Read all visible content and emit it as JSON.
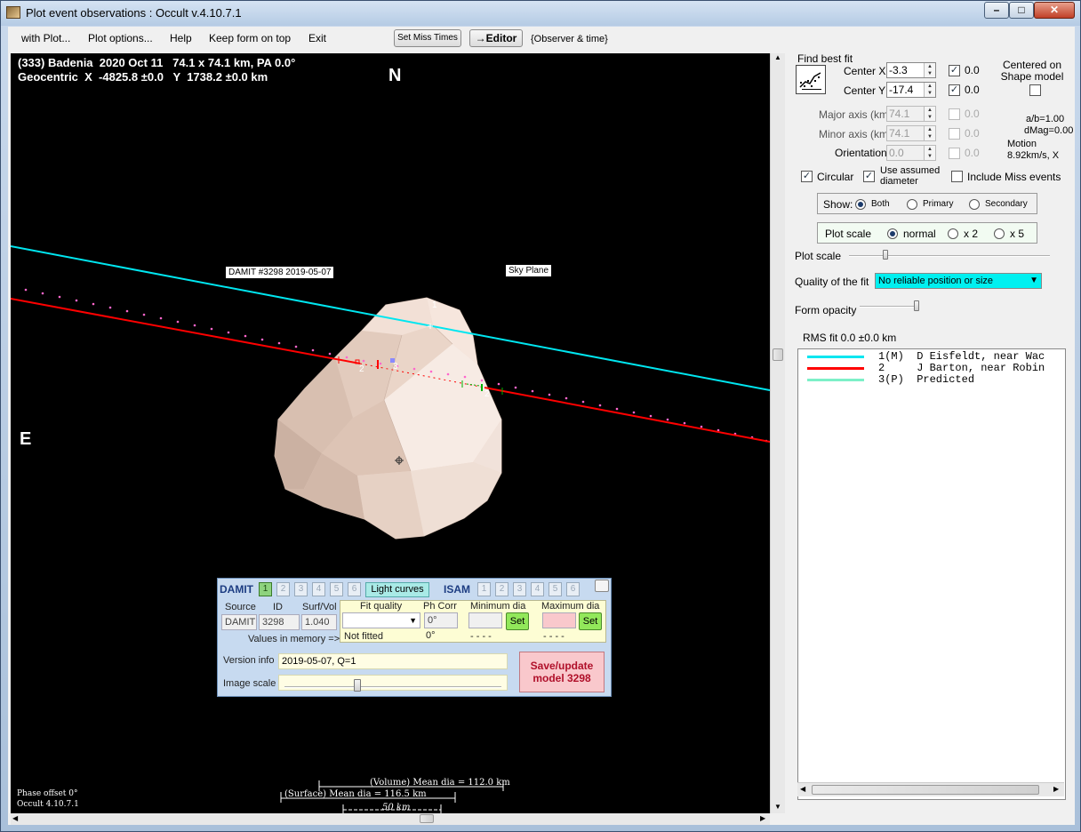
{
  "window": {
    "title": "Plot event observations : Occult v.4.10.7.1"
  },
  "menu": {
    "items": [
      "with Plot...",
      "Plot options...",
      "Help",
      "Keep form on top",
      "Exit"
    ],
    "set_miss_times": "Set Miss Times",
    "editor": "→Editor",
    "observer_time": "{Observer & time}"
  },
  "plot": {
    "header_line1": "(333) Badenia  2020 Oct 11   74.1 x 74.1 km, PA 0.0°",
    "header_line2": "Geocentric  X  -4825.8 ±0.0   Y  1738.2 ±0.0 km",
    "north": "N",
    "east": "E",
    "damit_tag": "DAMIT #3298 2019-05-07",
    "sky_plane_tag": "Sky Plane",
    "chord_labels": [
      "1",
      "2",
      "3",
      "2"
    ],
    "phase_offset": "Phase offset 0°",
    "occult_version": "Occult 4.10.7.1",
    "volume_mean_dia": "(Volume) Mean dia = 112.0 km",
    "surface_mean_dia": "(Surface) Mean dia = 116.5 km",
    "scale_bar": "50 km",
    "colors": {
      "chord1": "#00e6f0",
      "chord2": "#ff0000",
      "predicted": "#ff66cc",
      "body": "#ecd8cc"
    }
  },
  "damit": {
    "label": "DAMIT",
    "isam_label": "ISAM",
    "model_numbers": [
      "1",
      "2",
      "3",
      "4",
      "5",
      "6"
    ],
    "active_model": "1",
    "light_curves": "Light curves",
    "source_header": "Source",
    "id_header": "ID",
    "surfvol_header": "Surf/Vol",
    "source_value": "DAMIT",
    "id_value": "3298",
    "surfvol_value": "1.040",
    "values_in_memory": "Values in memory =>",
    "fit_quality_header": "Fit quality",
    "ph_corr_header": "Ph Corr",
    "min_dia_header": "Minimum dia",
    "max_dia_header": "Maximum dia",
    "ph_corr_value": "0°",
    "not_fitted": "Not fitted",
    "ph_corr_memory": "0°",
    "min_dia_memory": "- - - -",
    "max_dia_memory": "- - - -",
    "set_label": "Set",
    "version_info_label": "Version info",
    "version_info_value": "2019-05-07, Q=1",
    "image_scale_label": "Image scale",
    "save_line1": "Save/update",
    "save_line2": "model 3298",
    "image_scale_fraction": 0.33
  },
  "fit": {
    "find_best_fit": "Find best fit",
    "center_x_label": "Center X",
    "center_x": "-3.3",
    "center_x_fit": "0.0",
    "center_y_label": "Center Y",
    "center_y": "-17.4",
    "center_y_fit": "0.0",
    "centered_on_shape": "Centered on Shape model",
    "major_axis_label": "Major axis (km)",
    "major_axis": "74.1",
    "major_fit": "0.0",
    "minor_axis_label": "Minor axis (km)",
    "minor_axis": "74.1",
    "minor_fit": "0.0",
    "orientation_label": "Orientation",
    "orientation": "0.0",
    "orientation_fit": "0.0",
    "ab_ratio": "a/b=1.00",
    "dmag": "dMag=0.00",
    "motion_label": "Motion",
    "motion_value": "8.92km/s, X",
    "circular": "Circular",
    "use_assumed_diameter": "Use assumed diameter",
    "include_miss_events": "Include Miss events",
    "show_label": "Show:",
    "show_options": [
      "Both",
      "Primary",
      "Secondary"
    ],
    "show_selected": "Both",
    "plot_scale_label": "Plot scale",
    "plot_scale_options": [
      "normal",
      "x 2",
      "x 5"
    ],
    "plot_scale_selected": "normal",
    "plot_scale_slider_label": "Plot scale",
    "quality_label": "Quality of the fit",
    "quality_value": "No reliable position or size",
    "form_opacity_label": "Form opacity",
    "rms_fit": "RMS fit 0.0 ±0.0 km"
  },
  "observers": [
    {
      "text": "1(M)  D Eisfeldt, near Wac",
      "color": "#00e6f0"
    },
    {
      "text": "2     J Barton, near Robin",
      "color": "#ff0000"
    },
    {
      "text": "3(P)  Predicted",
      "color": "#7cf0c8"
    }
  ]
}
